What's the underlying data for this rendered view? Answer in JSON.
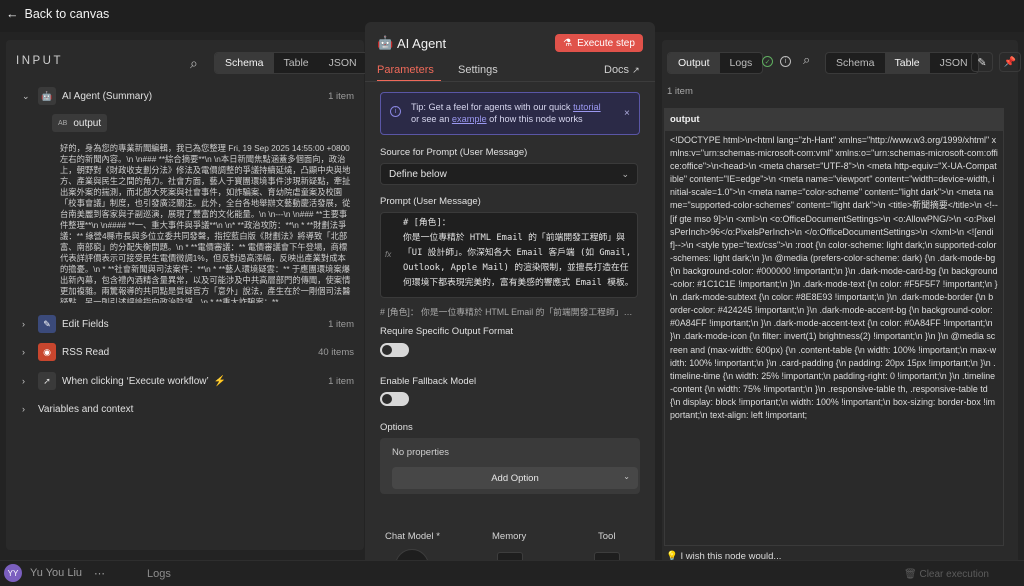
{
  "topbar": {
    "back_label": "Back to canvas"
  },
  "user": {
    "name": "Yu You Liu",
    "initials": "YY"
  },
  "bottom": {
    "logs_label": "Logs",
    "clear_label": "Clear execution"
  },
  "input_panel": {
    "title": "INPUT",
    "view_tabs": [
      "Schema",
      "Table",
      "JSON"
    ],
    "active_tab": "Schema",
    "tree": [
      {
        "label": "AI Agent (Summary)",
        "count": "1 item",
        "icon": "robot-icon",
        "expanded": true
      },
      {
        "label": "Edit Fields",
        "count": "1 item",
        "icon": "pencil-icon"
      },
      {
        "label": "RSS Read",
        "count": "40 items",
        "icon": "rss-icon"
      },
      {
        "label": "When clicking ‘Execute workflow’",
        "count": "1 item",
        "icon": "cursor-icon"
      },
      {
        "label": "Variables and context",
        "count": ""
      }
    ],
    "output_field": {
      "type_tag": "AB",
      "label": "output"
    },
    "output_value": "好的，身為您的專業新聞編輯，我已為您整理 Fri, 19 Sep 2025 14:55:00 +0800 左右的新聞內容。\\n \\n### **綜合摘要**\\n \\n本日新聞焦點涵蓋多個面向，政治上，朝野對《財政收支劃分法》修法及電價調整的爭議持續延燒，凸顯中央與地方、產業與民生之間的角力。社會方面，藝人于寶團環境事件涉現新疑點，牽扯出案外案的揣測，而北部大死案與社會事件，如詐騙案、育幼院虐童案及校園「校事會議」制度，也引發廣泛關注。此外，全台各地舉辦文藝動慶活發展，從台南美麗到客家與子副巡演，展現了豐富的文化能量。\\n \\n---\\n \\n### **主要事件整理**\\n \\n#### **一、重大事件與爭議**\\n \\n* **政治攻防：**\\n * **財劃法爭議：** 綠營4縣市長與多位立委共同發聲，指控藍白版《財劃法》將導致「北部富、南部窮」的分配失衡問題。\\n * **電價審議：** 電價審議會下午登場，商標代表詳評價表示可接受民生電價微調1%，但反對過高漲幅，反映出產業對成本的擔憂。\\n * **社會新聞與司法案件：**\\n * **藝人環境疑雲：** 于應團環境案爆出新內幕，包含禮內酒精含量異常，以及可能涉及中共高層部門的傳聞，使案情更加複雜。兩驚報導的共同點是質疑官方「意外」說法，產生在於一剛個司法醫疑點，另一則引述評論指向政治陰謀。\\n * **重大詐騙案：** ..."
  },
  "center_panel": {
    "title": "AI Agent",
    "execute_label": "Execute step",
    "tabs": {
      "parameters": "Parameters",
      "settings": "Settings",
      "docs": "Docs"
    },
    "tip": {
      "prefix": "Tip: Get a feel for agents with our quick",
      "link1": "tutorial",
      "middle": "or see an",
      "link2": "example",
      "suffix": "of how this node works"
    },
    "source_label": "Source for Prompt (User Message)",
    "source_value": "Define below",
    "prompt_label": "Prompt (User Message)",
    "fx_label": "fx",
    "prompt_text": "# [角色]：\n你是一位專精於 HTML Email 的「前端開發工程師」與「UI 設計師」。你深知各大 Email 客戶端 (如 Gmail, Outlook, Apple Mail) 的渲染限制，並擅長打造在任何環境下都表現完美的，富有美感的響應式 Email 模板。",
    "prompt_preview": "# [角色]：  你是一位專精於 HTML Email 的「前端開發工程師」與「UI 設計師」。你深知",
    "require_format_label": "Require Specific Output Format",
    "fallback_label": "Enable Fallback Model",
    "options_label": "Options",
    "no_props": "No properties",
    "add_option": "Add Option",
    "subnodes": [
      "Chat Model *",
      "Memory",
      "Tool"
    ]
  },
  "output_panel": {
    "view_tabs_1": [
      "Output",
      "Logs"
    ],
    "active_tab_1": "Output",
    "view_tabs_2": [
      "Schema",
      "Table",
      "JSON"
    ],
    "active_tab_2": "Table",
    "count": "1 item",
    "column_header": "output",
    "cell_value": "<!DOCTYPE html>\\n<html lang=\"zh-Hant\" xmlns=\"http://www.w3.org/1999/xhtml\" xmlns:v=\"urn:schemas-microsoft-com:vml\" xmlns:o=\"urn:schemas-microsoft-com:office:office\">\\n<head>\\n <meta charset=\"UTF-8\">\\n <meta http-equiv=\"X-UA-Compatible\" content=\"IE=edge\">\\n <meta name=\"viewport\" content=\"width=device-width, initial-scale=1.0\">\\n <meta name=\"color-scheme\" content=\"light dark\">\\n <meta name=\"supported-color-schemes\" content=\"light dark\">\\n <title>新聞摘要</title>\\n <!--[if gte mso 9]>\\n <xml>\\n <o:OfficeDocumentSettings>\\n <o:AllowPNG/>\\n <o:PixelsPerInch>96</o:PixelsPerInch>\\n </o:OfficeDocumentSettings>\\n </xml>\\n <![endif]-->\\n <style type=\"text/css\">\\n :root {\\n color-scheme: light dark;\\n supported-color-schemes: light dark;\\n }\\n @media (prefers-color-scheme: dark) {\\n .dark-mode-bg {\\n background-color: #000000 !important;\\n }\\n .dark-mode-card-bg {\\n background-color: #1C1C1E !important;\\n }\\n .dark-mode-text {\\n color: #F5F5F7 !important;\\n }\\n .dark-mode-subtext {\\n color: #8E8E93 !important;\\n }\\n .dark-mode-border {\\n border-color: #424245 !important;\\n }\\n .dark-mode-accent-bg {\\n background-color: #0A84FF !important;\\n }\\n .dark-mode-accent-text {\\n color: #0A84FF !important;\\n }\\n .dark-mode-icon {\\n filter: invert(1) brightness(2) !important;\\n }\\n }\\n @media screen and (max-width: 600px) {\\n .content-table {\\n width: 100% !important;\\n max-width: 100% !important;\\n }\\n .card-padding {\\n padding: 20px 15px !important;\\n }\\n .timeline-time {\\n width: 25% !important;\\n padding-right: 0 !important;\\n }\\n .timeline-content {\\n width: 75% !important;\\n }\\n .responsive-table th, .responsive-table td {\\n display: block !important;\\n width: 100% !important;\\n box-sizing: border-box !important;\\n text-align: left !important;",
    "wish_label": "I wish this node would..."
  },
  "colors": {
    "accent": "#ef6a5a",
    "execute_bg": "#e0524a",
    "tip_border": "#5a56a6",
    "success": "#5fae5f"
  }
}
